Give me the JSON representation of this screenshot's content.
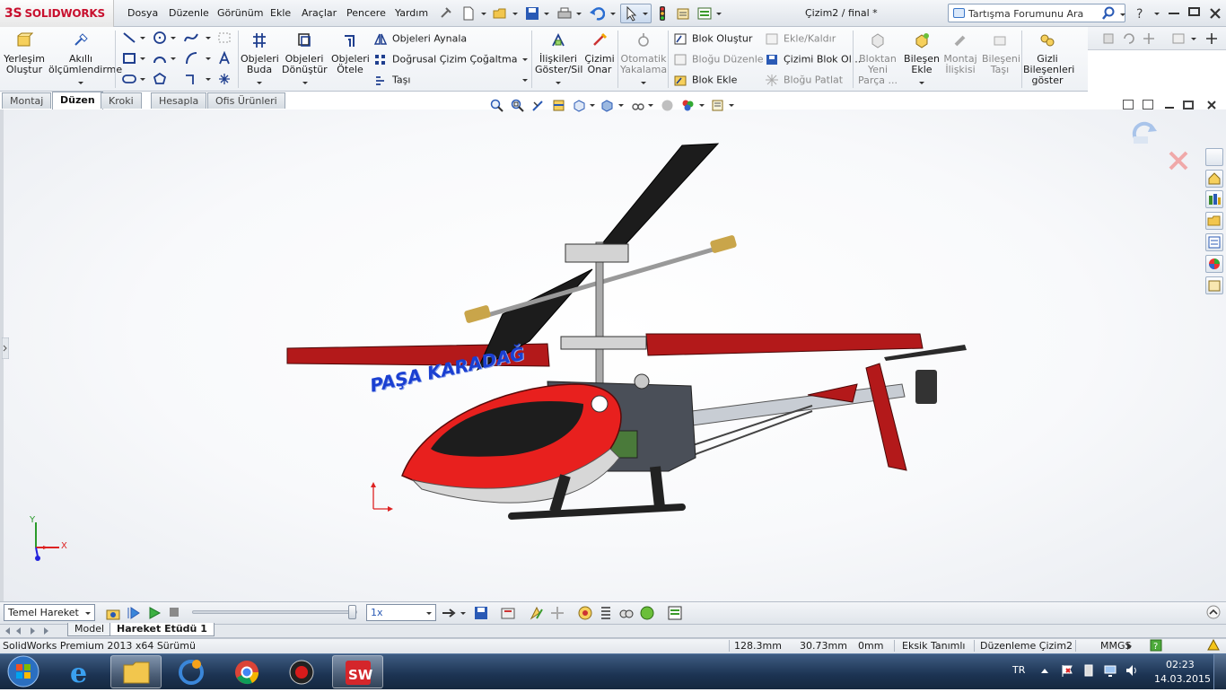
{
  "app": {
    "logo_prefix": "3S",
    "logo_text": "SOLIDWORKS",
    "doc_title": "Çizim2 / final *"
  },
  "menu": [
    "Dosya",
    "Düzenle",
    "Görünüm",
    "Ekle",
    "Araçlar",
    "Pencere",
    "Yardım"
  ],
  "search": {
    "placeholder": "Tartışma Forumunu Ara"
  },
  "ribbon": {
    "layout_btn": [
      "Yerleşim",
      "Oluştur"
    ],
    "smart_dim": [
      "Akıllı",
      "ölçümlendirme"
    ],
    "trim": [
      "Objeleri",
      "Buda"
    ],
    "convert": [
      "Objeleri",
      "Dönüştür"
    ],
    "offset": [
      "Objeleri",
      "Ötele"
    ],
    "mirror": "Objeleri Aynala",
    "linear_pattern": "Doğrusal Çizim Çoğaltma",
    "move": "Taşı",
    "relations": [
      "İlişkileri",
      "Göster/Sil"
    ],
    "repair": [
      "Çizimi",
      "Onar"
    ],
    "autosnap": [
      "Otomatik",
      "Yakalama"
    ],
    "make_block": "Blok Oluştur",
    "edit_block": "Bloğu Düzenle",
    "insert_block": "Blok Ekle",
    "add_remove": "Ekle/Kaldır",
    "save_block": "Çizimi Blok Ol...",
    "explode_block": "Bloğu Patlat",
    "block_to_part": [
      "Bloktan",
      "Yeni",
      "Parça ..."
    ],
    "insert_comp": [
      "Bileşen",
      "Ekle"
    ],
    "mate": [
      "Montaj",
      "İlişkisi"
    ],
    "move_comp": [
      "Bileşeni",
      "Taşı"
    ],
    "show_hidden": [
      "Gizli",
      "Bileşenleri",
      "göster"
    ]
  },
  "tabs": [
    "Montaj",
    "Düzen",
    "Kroki",
    "Hesapla",
    "Ofis Ürünleri"
  ],
  "active_tab": "Düzen",
  "model": {
    "watermark_text": "PAŞA KARADAĞ",
    "axis_x": "X",
    "axis_y": "Y"
  },
  "motion": {
    "study_type": "Temel Hareket",
    "speed": "1x"
  },
  "sheets": [
    "Model",
    "Hareket Etüdü 1"
  ],
  "status": {
    "version": "SolidWorks Premium 2013 x64 Sürümü",
    "x": "128.3mm",
    "y": "30.73mm",
    "z": "0mm",
    "defined": "Eksik Tanımlı",
    "editing": "Düzenleme Çizim2",
    "units": "MMGS"
  },
  "tray": {
    "lang": "TR",
    "time": "02:23",
    "date": "14.03.2015"
  },
  "colors": {
    "brand_red": "#c8102e",
    "body_red": "#e8201e",
    "blade_red": "#b3191a"
  }
}
